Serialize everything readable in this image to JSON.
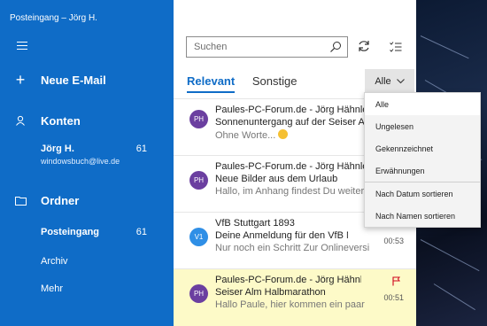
{
  "window": {
    "title": "Posteingang – Jörg H."
  },
  "sidebar": {
    "new_mail": "Neue E-Mail",
    "accounts_heading": "Konten",
    "account": {
      "name": "Jörg H.",
      "email": "windowsbuch@live.de",
      "unread": "61"
    },
    "folders_heading": "Ordner",
    "folders": [
      {
        "label": "Posteingang",
        "count": "61"
      },
      {
        "label": "Archiv",
        "count": ""
      },
      {
        "label": "Mehr",
        "count": ""
      }
    ]
  },
  "toolbar": {
    "search_placeholder": "Suchen"
  },
  "tabs": {
    "focused": "Relevant",
    "other": "Sonstige"
  },
  "filter": {
    "selected": "Alle",
    "options": [
      "Alle",
      "Ungelesen",
      "Gekennzeichnet",
      "Erwähnungen"
    ],
    "sort_options": [
      "Nach Datum sortieren",
      "Nach Namen sortieren"
    ]
  },
  "messages": [
    {
      "initials": "PH",
      "avatar_color": "#6b3fa0",
      "sender": "Paules-PC-Forum.de - Jörg Hähnle",
      "subject": "Sonnenuntergang auf der Seiser Alm",
      "preview": "Ohne Worte... ",
      "time": "",
      "flagged": false,
      "highlight": false
    },
    {
      "initials": "PH",
      "avatar_color": "#6b3fa0",
      "sender": "Paules-PC-Forum.de - Jörg Hähnle",
      "subject": "Neue Bilder aus dem Urlaub",
      "preview": "Hallo, im Anhang findest Du weitere",
      "time": "",
      "flagged": false,
      "highlight": false
    },
    {
      "initials": "V1",
      "avatar_color": "#2f8fe6",
      "sender": "VfB Stuttgart 1893",
      "subject": "Deine Anmeldung für den VfB Newsletter",
      "preview": "Nur noch ein Schritt Zur Onlineversion",
      "time": "00:53",
      "flagged": false,
      "highlight": false
    },
    {
      "initials": "PH",
      "avatar_color": "#6b3fa0",
      "sender": "Paules-PC-Forum.de - Jörg Hähnle",
      "subject": "Seiser Alm Halbmarathon",
      "preview": "Hallo Paule, hier kommen ein paar",
      "time": "00:51",
      "flagged": true,
      "highlight": true
    }
  ],
  "colors": {
    "accent": "#0f6cc7",
    "highlight": "#fdfac8",
    "flag": "#d0021b"
  }
}
